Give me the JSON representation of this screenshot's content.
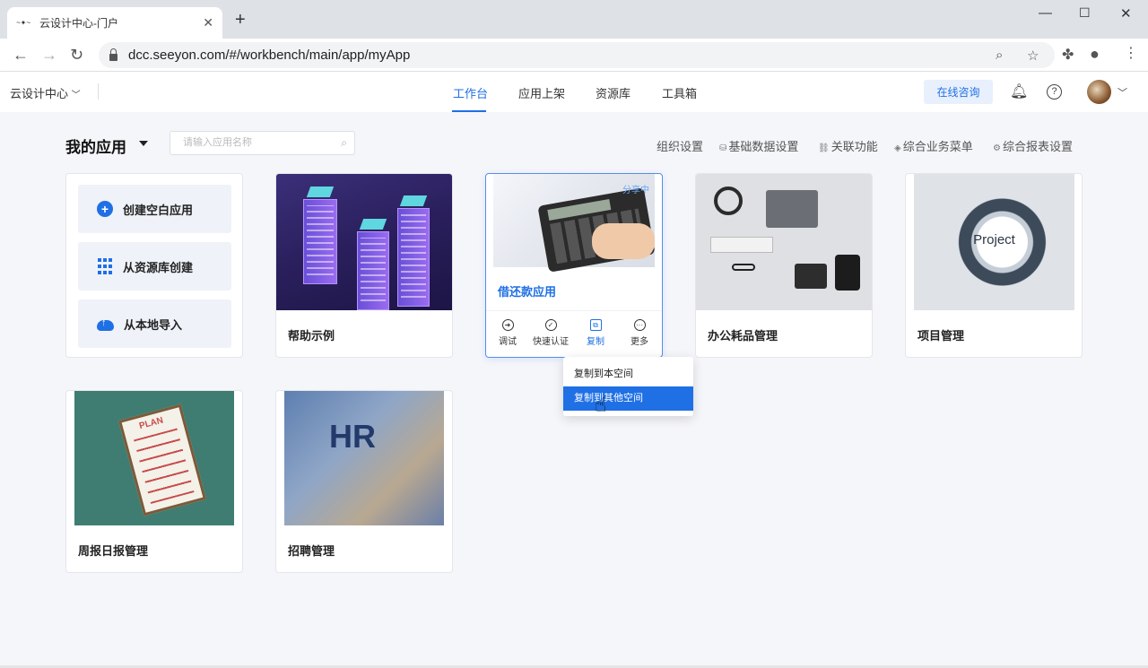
{
  "browser": {
    "tab_title": "云设计中心-门户",
    "tab_favicon": "seeyon",
    "url": "dcc.seeyon.com/#/workbench/main/app/myApp"
  },
  "header": {
    "brand": "云设计中心",
    "nav": [
      "工作台",
      "应用上架",
      "资源库",
      "工具箱"
    ],
    "active_nav": "工作台",
    "consult": "在线咨询"
  },
  "page": {
    "title": "我的应用",
    "search_placeholder": "请输入应用名称",
    "toolbar": [
      "组织设置",
      "基础数据设置",
      "关联功能",
      "综合业务菜单",
      "综合报表设置"
    ]
  },
  "create_panel": {
    "buttons": [
      "创建空白应用",
      "从资源库创建",
      "从本地导入"
    ]
  },
  "apps": [
    {
      "name": "帮助示例"
    },
    {
      "name": "借还款应用",
      "badge": "分享中",
      "selected": true
    },
    {
      "name": "办公耗品管理"
    },
    {
      "name": "项目管理",
      "image_text": "Project"
    },
    {
      "name": "周报日报管理",
      "image_text": "PLAN"
    },
    {
      "name": "招聘管理",
      "image_text": "HR"
    }
  ],
  "card_actions": [
    "调试",
    "快速认证",
    "复制",
    "更多"
  ],
  "active_action": "复制",
  "copy_menu": {
    "items": [
      "复制到本空间",
      "复制到其他空间"
    ],
    "hovered_index": 1
  },
  "colors": {
    "accent": "#1f6fe5",
    "page_bg": "#f5f6fa",
    "consult_bg": "#e8f0fd"
  }
}
